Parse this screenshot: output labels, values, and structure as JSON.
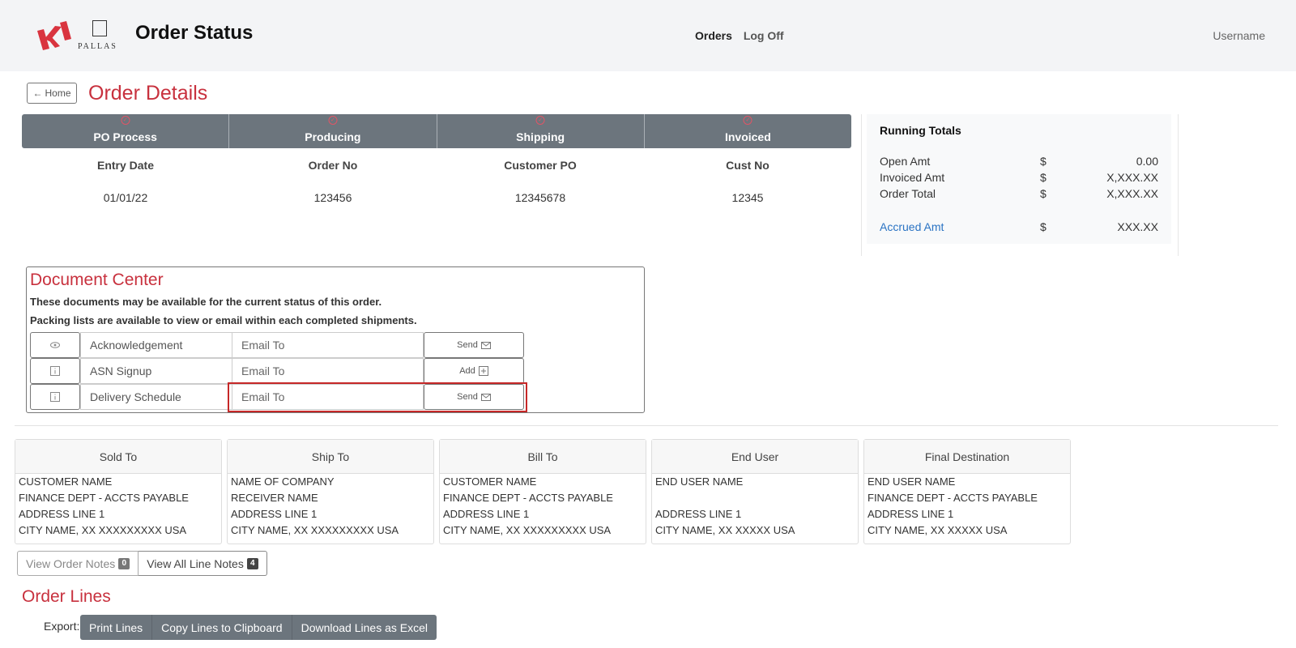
{
  "header": {
    "logo_brand": "KI",
    "logo_sub": "PALLAS",
    "app_title": "Order Status",
    "nav": {
      "orders": "Orders",
      "logoff": "Log Off"
    },
    "username": "Username"
  },
  "page": {
    "home_label": "Home",
    "title": "Order Details"
  },
  "stepper": {
    "steps": [
      {
        "label": "PO Process",
        "icon": "circle-check-icon"
      },
      {
        "label": "Producing",
        "icon": "circle-check-icon"
      },
      {
        "label": "Shipping",
        "icon": "circle-check-icon"
      },
      {
        "label": "Invoiced",
        "icon": "circle-check-icon"
      }
    ]
  },
  "order_info": [
    {
      "label": "Entry Date",
      "value": "01/01/22"
    },
    {
      "label": "Order No",
      "value": "123456"
    },
    {
      "label": "Customer PO",
      "value": "12345678"
    },
    {
      "label": "Cust No",
      "value": "12345"
    }
  ],
  "totals": {
    "title": "Running Totals",
    "rows": [
      {
        "label": "Open Amt",
        "currency": "$",
        "amount": "0.00"
      },
      {
        "label": "Invoiced Amt",
        "currency": "$",
        "amount": "X,XXX.XX"
      },
      {
        "label": "Order Total",
        "currency": "$",
        "amount": "X,XXX.XX"
      },
      {
        "label": "Accrued Amt",
        "currency": "$",
        "amount": "XXX.XX"
      }
    ]
  },
  "document_center": {
    "title": "Document Center",
    "line1": "These documents may be available for the current status of this order.",
    "line2": "Packing lists are available to view or email within each completed shipments.",
    "rows": [
      {
        "icon": "eye-icon",
        "name": "Acknowledgement",
        "email_placeholder": "Email To",
        "action": "Send"
      },
      {
        "icon": "info-icon",
        "name": "ASN Signup",
        "email_placeholder": "Email To",
        "action": "Add"
      },
      {
        "icon": "info-icon",
        "name": "Delivery Schedule",
        "email_placeholder": "Email To",
        "action": "Send"
      }
    ]
  },
  "addresses": [
    {
      "title": "Sold To",
      "lines": [
        "CUSTOMER NAME",
        "FINANCE DEPT - ACCTS PAYABLE",
        "ADDRESS LINE 1",
        "CITY NAME, XX XXXXXXXXX USA"
      ]
    },
    {
      "title": "Ship To",
      "lines": [
        "NAME OF COMPANY",
        "RECEIVER NAME",
        "ADDRESS LINE 1",
        "CITY NAME, XX XXXXXXXXX USA"
      ]
    },
    {
      "title": "Bill To",
      "lines": [
        "CUSTOMER NAME",
        "FINANCE DEPT - ACCTS PAYABLE",
        "ADDRESS LINE 1",
        "CITY NAME, XX XXXXXXXXX USA"
      ]
    },
    {
      "title": "End User",
      "lines": [
        "END USER NAME",
        "",
        "ADDRESS LINE 1",
        "CITY NAME, XX XXXXX USA"
      ]
    },
    {
      "title": "Final Destination",
      "lines": [
        "END USER NAME",
        "FINANCE DEPT - ACCTS PAYABLE",
        "ADDRESS LINE 1",
        "CITY NAME, XX XXXXX USA"
      ]
    }
  ],
  "notes": {
    "order_notes": {
      "label": "View Order Notes",
      "count": "0"
    },
    "line_notes": {
      "label": "View All Line Notes",
      "count": "4"
    }
  },
  "order_lines": {
    "title": "Order Lines",
    "export_label": "Export:",
    "buttons": [
      "Print Lines",
      "Copy Lines to Clipboard",
      "Download Lines as Excel"
    ]
  },
  "colors": {
    "accent_red": "#c8313e",
    "stepper_grey": "#6c757d",
    "link_blue": "#2a73c3"
  }
}
